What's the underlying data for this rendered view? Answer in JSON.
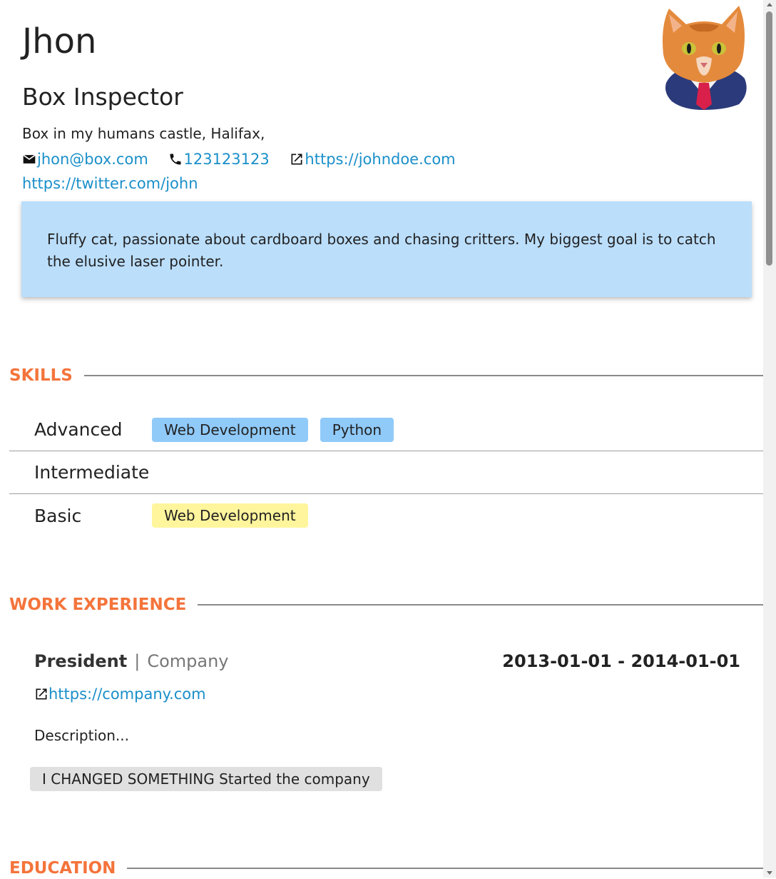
{
  "basics": {
    "name": "Jhon",
    "label": "Box Inspector",
    "location": "Box in my humans castle, Halifax,",
    "email": "jhon@box.com",
    "phone": "123123123",
    "website": "https://johndoe.com",
    "twitter": "https://twitter.com/john",
    "summary": "Fluffy cat, passionate about cardboard boxes and chasing critters. My biggest goal is to catch the elusive laser pointer."
  },
  "sections": {
    "skills": "SKILLS",
    "work": "WORK EXPERIENCE",
    "education": "EDUCATION"
  },
  "skills": [
    {
      "level": "Advanced",
      "items": [
        "Web Development",
        "Python"
      ]
    },
    {
      "level": "Intermediate",
      "items": []
    },
    {
      "level": "Basic",
      "items": [
        "Web Development"
      ]
    }
  ],
  "work": {
    "position": "President",
    "separator": "|",
    "company": "Company",
    "dates": "2013-01-01 - 2014-01-01",
    "url": "https://company.com",
    "description": "Description...",
    "highlight": "I CHANGED SOMETHING Started the company"
  },
  "colors": {
    "accent": "#f4743b",
    "link": "#1a8fc9",
    "summary_bg": "#bbdefb",
    "chip_advanced": "#90caf9",
    "chip_basic": "#fff59d",
    "chip_highlight": "#e0e0e0"
  },
  "icons": {
    "email": "mail-icon",
    "phone": "phone-icon",
    "website": "external-link-icon"
  }
}
